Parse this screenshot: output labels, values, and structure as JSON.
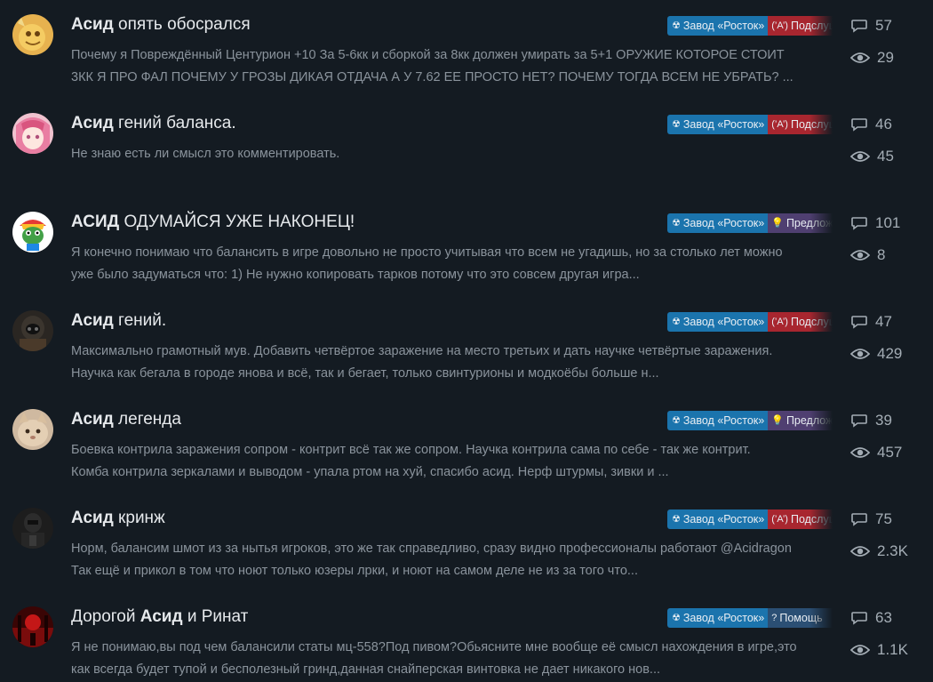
{
  "colors": {
    "background": "#141b22",
    "title": "#e6e9ec",
    "snippet": "#8a939c",
    "stat": "#a4adb5",
    "tag_main": "#1b74ad",
    "tag_red": "#a8262f",
    "tag_purple": "#4f3f71",
    "tag_help": "#2b4f74"
  },
  "icons": {
    "comment": "comment-bubble-icon",
    "views": "eye-icon",
    "radiation": "radiation-icon",
    "announce": "broadcast-icon",
    "idea": "lightbulb-icon",
    "help": "question-circle-icon"
  },
  "topics": [
    {
      "title_before": "",
      "title_bold": "Асид",
      "title_after": " опять обосрался",
      "snippet_lines": [
        "Почему я Повреждённый Центурион +10 За 5-6кк и сборкой за 8кк должен умирать за 5+1 ОРУЖИЕ КОТОРОЕ СТОИТ",
        "3КК Я ПРО ФАЛ ПОЧЕМУ У ГРОЗЫ ДИКАЯ ОТДАЧА А У 7.62 ЕЕ ПРОСТО НЕТ? ПОЧЕМУ ТОГДА ВСЕМ НЕ УБРАТЬ? ..."
      ],
      "tag_main": "Завод «Росток»",
      "tag_sec": "Подслушано",
      "tag_sec_kind": "red",
      "replies": "57",
      "views": "29",
      "avatar": "golden-creature-avatar"
    },
    {
      "title_before": "",
      "title_bold": "Асид",
      "title_after": " гений баланса.",
      "snippet_lines": [
        "Не знаю есть ли смысл это комментировать."
      ],
      "tag_main": "Завод «Росток»",
      "tag_sec": "Подслушано",
      "tag_sec_kind": "red",
      "replies": "46",
      "views": "45",
      "avatar": "pink-anime-girl-avatar"
    },
    {
      "title_before": "",
      "title_bold": "АСИД",
      "title_after": " ОДУМАЙСЯ УЖЕ НАКОНЕЦ!",
      "snippet_lines": [
        "Я конечно понимаю что балансить в игре довольно не просто учитывая что всем не угадишь, но за столько лет можно",
        "уже было задуматься что: 1) Не нужно копировать тарков потому что это совсем другая игра..."
      ],
      "tag_main": "Завод «Росток»",
      "tag_sec": "Предложения",
      "tag_sec_kind": "purple",
      "replies": "101",
      "views": "8",
      "avatar": "rainbow-frog-avatar"
    },
    {
      "title_before": "",
      "title_bold": "Асид",
      "title_after": " гений.",
      "snippet_lines": [
        "Максимально грамотный мув. Добавить четвёртое заражение на место третьих и дать научке четвёртые заражения.",
        "Научка как бегала в городе янова и всё, так и бегает, только свинтурионы и модкоёбы больше н..."
      ],
      "tag_main": "Завод «Росток»",
      "tag_sec": "Подслушано",
      "tag_sec_kind": "red",
      "replies": "47",
      "views": "429",
      "avatar": "armored-stalker-avatar"
    },
    {
      "title_before": "",
      "title_bold": "Асид",
      "title_after": " легенда",
      "snippet_lines": [
        "Боевка контрила заражения сопром - контрит всё так же сопром. Научка контрила сама по себе - так же контрит.",
        "Комба контрила зеркалами и выводом - упала ртом на хуй, спасибо асид. Нерф штурмы, зивки и ..."
      ],
      "tag_main": "Завод «Росток»",
      "tag_sec": "Предложения",
      "tag_sec_kind": "purple",
      "replies": "39",
      "views": "457",
      "avatar": "cat-face-avatar"
    },
    {
      "title_before": "",
      "title_bold": "Асид",
      "title_after": " кринж",
      "snippet_lines": [
        "Норм, балансим шмот из за нытья игроков, это же так справедливо, сразу видно профессионалы работают @Acidragon",
        "Так ещё и прикол в том что ноют только юзеры лрки, и ноют на самом деле не из за того что..."
      ],
      "tag_main": "Завод «Росток»",
      "tag_sec": "Подслушано",
      "tag_sec_kind": "red",
      "replies": "75",
      "views": "2.3K",
      "avatar": "dark-suit-avatar"
    },
    {
      "title_before": "Дорогой ",
      "title_bold": "Асид",
      "title_after": " и Ринат",
      "snippet_lines": [
        "Я не понимаю,вы под чем балансили статы мц-558?Под пивом?Обьясните мне вообще её смысл нахождения в игре,это",
        "как всегда будет тупой и бесполезный гринд,данная снайперская винтовка не дает никакого нов..."
      ],
      "tag_main": "Завод «Росток»",
      "tag_sec": "Помощь",
      "tag_sec_kind": "help",
      "replies": "63",
      "views": "1.1K",
      "avatar": "red-dark-scene-avatar"
    }
  ]
}
